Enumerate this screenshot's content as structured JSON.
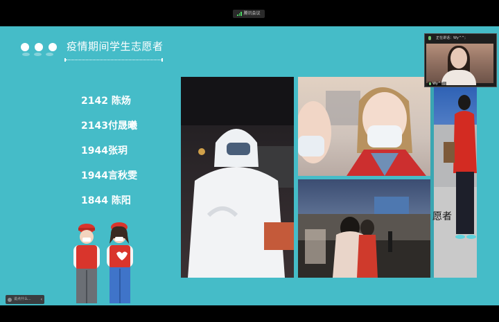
{
  "meeting": {
    "title": "腾讯会议"
  },
  "slide": {
    "title": "疫情期间学生志愿者",
    "names": [
      "2142 陈炀",
      "2143付晟曦",
      "1944张玥",
      "1944言秋雯",
      "1844 陈阳"
    ],
    "side_fragment": "愿者"
  },
  "presenter": {
    "status": "正在讲话：Wy^^;",
    "name": "Wy^^;"
  },
  "chat": {
    "placeholder": "说点什么..."
  },
  "colors": {
    "slide_bg": "#45bcc8",
    "vest_red": "#d9352c"
  }
}
